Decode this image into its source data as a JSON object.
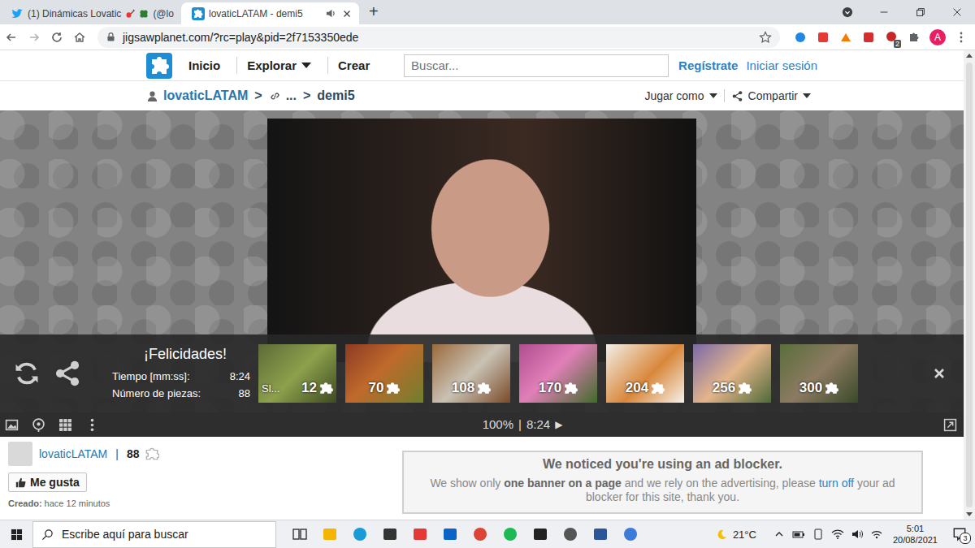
{
  "browser": {
    "tabs": [
      {
        "title": "(1) Dinámicas Lovatic",
        "tail": "(@lo",
        "selected": false,
        "audio": false
      },
      {
        "title": "lovaticLATAM - demi5",
        "selected": true,
        "audio": true
      }
    ],
    "new_tab": "+",
    "url": "jigsawplanet.com/?rc=play&pid=2f7153350ede",
    "extension_badge": "2",
    "profile": "A"
  },
  "site": {
    "nav": [
      {
        "label": "Inicio",
        "dropdown": false
      },
      {
        "label": "Explorar",
        "dropdown": true
      },
      {
        "label": "Crear",
        "dropdown": false
      }
    ],
    "search_placeholder": "Buscar...",
    "register": "Regístrate",
    "login": "Iniciar sesión"
  },
  "breadcrumb": {
    "user": "lovaticLATAM",
    "separator": ">",
    "ellipsis": "...",
    "current": "demi5",
    "actions": [
      {
        "label": "Jugar como",
        "dropdown": true
      },
      {
        "label": "Compartir",
        "dropdown": true
      }
    ]
  },
  "result": {
    "title": "¡Felicidades!",
    "time_label": "Tiempo [mm:ss]:",
    "time": "8:24",
    "pieces_label": "Número de piezas:",
    "pieces": "88"
  },
  "suggestions": [
    {
      "pieces": "12",
      "caption": "Sl..."
    },
    {
      "pieces": "70"
    },
    {
      "pieces": "108"
    },
    {
      "pieces": "170"
    },
    {
      "pieces": "204"
    },
    {
      "pieces": "256"
    },
    {
      "pieces": "300"
    }
  ],
  "toolbar": {
    "zoom": "100%",
    "separator": "|",
    "timer": "8:24",
    "play": "▶"
  },
  "puzzle_info": {
    "author": "lovaticLATAM",
    "separator": "|",
    "pieces": "88",
    "like": "Me gusta",
    "created_label": "Creado:",
    "created": "hace 12 minutos"
  },
  "ad_notice": {
    "title": "We noticed you're using an ad blocker.",
    "text_before": "We show only ",
    "bold": "one banner on a page",
    "text_middle": " and we rely on the advertising, please ",
    "link": "turn off",
    "text_after": " your ad blocker for this site, thank you."
  },
  "taskbar": {
    "search_placeholder": "Escribe aquí para buscar",
    "weather": "21°C",
    "time": "5:01",
    "date": "20/08/2021",
    "notifications": "3"
  }
}
